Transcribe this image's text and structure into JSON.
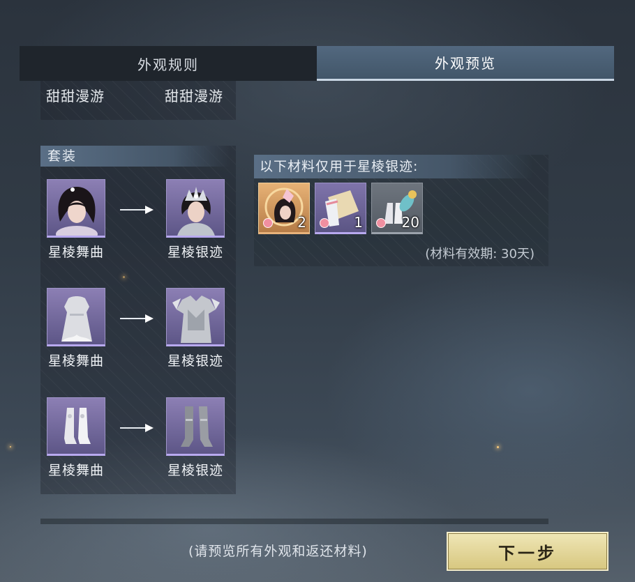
{
  "tabs": {
    "rules_label": "外观规则",
    "preview_label": "外观预览",
    "active": "外观预览"
  },
  "top_row": {
    "left_label": "甜甜漫游",
    "right_label": "甜甜漫游"
  },
  "outfit_section": {
    "title": "套装",
    "rows": [
      {
        "from_label": "星棱舞曲",
        "from_icon": "hair-icon",
        "to_label": "星棱银迹",
        "to_icon": "crown-hair-icon"
      },
      {
        "from_label": "星棱舞曲",
        "from_icon": "dress-icon",
        "to_label": "星棱银迹",
        "to_icon": "armor-icon"
      },
      {
        "from_label": "星棱舞曲",
        "from_icon": "boots-icon",
        "to_label": "星棱银迹",
        "to_icon": "greaves-icon"
      }
    ]
  },
  "materials": {
    "title": "以下材料仅用于星棱银迹:",
    "items": [
      {
        "icon": "hair-token-icon",
        "count": "2",
        "rarity": "gold"
      },
      {
        "icon": "outfit-token-icon",
        "count": "1",
        "rarity": "purple"
      },
      {
        "icon": "boots-token-icon",
        "count": "20",
        "rarity": "gray"
      }
    ],
    "validity": "(材料有效期: 30天)"
  },
  "footer": {
    "hint": "(请预览所有外观和返还材料)",
    "next_label": "下一步"
  },
  "colors": {
    "accent_tab": "#4b6076",
    "button_gold": "#e3d592",
    "thumb_purple": "#7369a0"
  }
}
